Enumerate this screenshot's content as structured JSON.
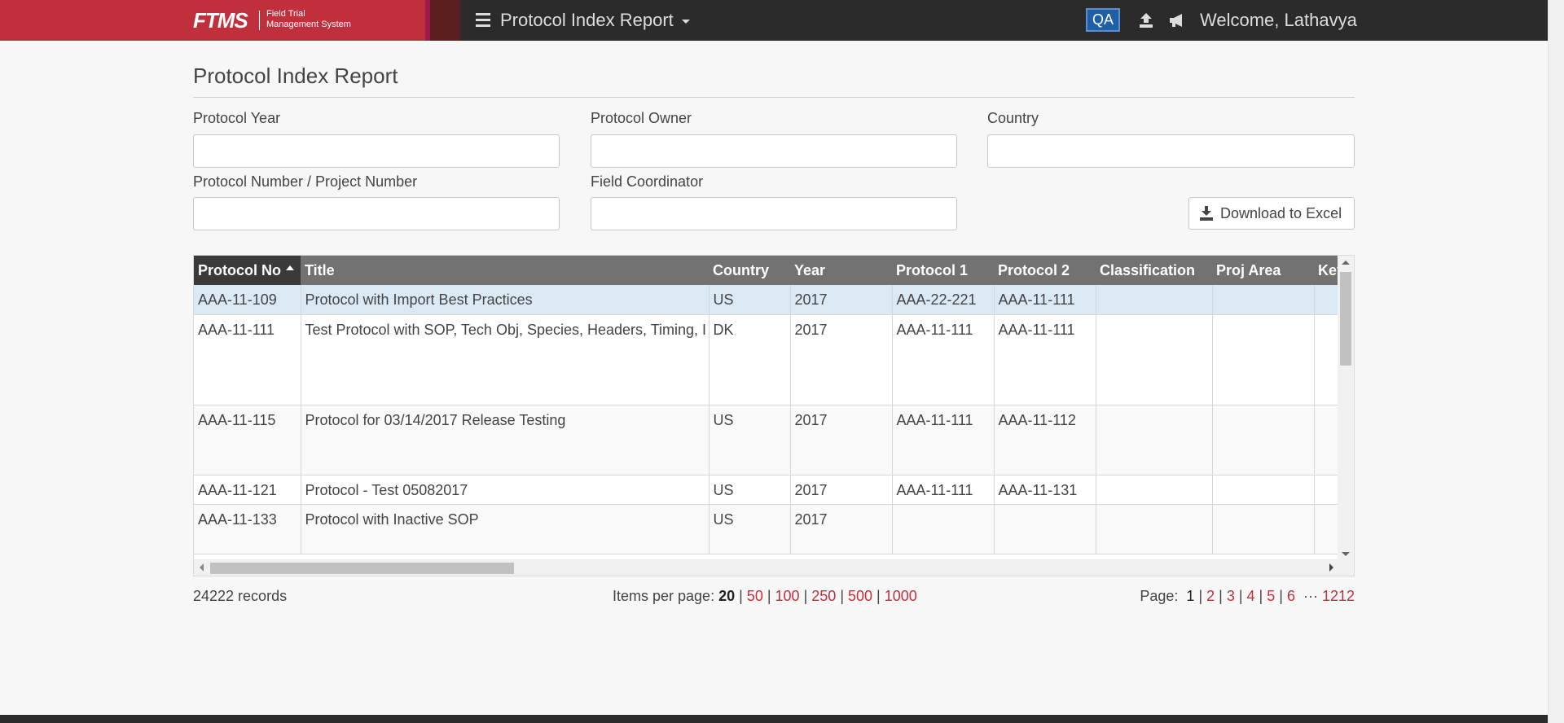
{
  "header": {
    "logo": "FTMS",
    "logo_sub_line1": "Field Trial",
    "logo_sub_line2": "Management System",
    "page_menu_label": "Protocol Index Report",
    "env_badge": "QA",
    "welcome": "Welcome, Lathavya"
  },
  "page": {
    "title": "Protocol Index Report"
  },
  "filters": {
    "protocol_year_label": "Protocol Year",
    "protocol_owner_label": "Protocol Owner",
    "country_label": "Country",
    "protocol_number_label": "Protocol Number / Project Number",
    "field_coordinator_label": "Field Coordinator",
    "protocol_year_value": "",
    "protocol_owner_value": "",
    "country_value": "",
    "protocol_number_value": "",
    "field_coordinator_value": "",
    "download_label": "Download to Excel"
  },
  "grid": {
    "columns": [
      "Protocol No",
      "Title",
      "Country",
      "Year",
      "Protocol 1",
      "Protocol 2",
      "Classification",
      "Proj Area",
      "Key"
    ],
    "rows": [
      [
        "AAA-11-109",
        "Protocol with Import Best Practices",
        "US",
        "2017",
        "AAA-22-221",
        "AAA-11-111",
        "",
        "",
        ""
      ],
      [
        "AAA-11-111",
        "Test Protocol with SOP, Tech Obj, Species, Headers, Timing, I",
        "DK",
        "2017",
        "AAA-11-111",
        "AAA-11-111",
        "",
        "",
        ""
      ],
      [
        "AAA-11-115",
        "Protocol for 03/14/2017 Release Testing",
        "US",
        "2017",
        "AAA-11-111",
        "AAA-11-112",
        "",
        "",
        ""
      ],
      [
        "AAA-11-121",
        "Protocol - Test 05082017",
        "US",
        "2017",
        "AAA-11-111",
        "AAA-11-131",
        "",
        "",
        ""
      ],
      [
        "AAA-11-133",
        "Protocol with Inactive SOP",
        "US",
        "2017",
        "",
        "",
        "",
        "",
        ""
      ]
    ]
  },
  "footer": {
    "records": "24222 records",
    "items_per_page_label": "Items per page:",
    "items_per_page_options": [
      "20",
      "50",
      "100",
      "250",
      "500",
      "1000"
    ],
    "page_label": "Page:",
    "pages": [
      "1",
      "2",
      "3",
      "4",
      "5",
      "6"
    ],
    "ellipsis": "···",
    "last_page": "1212"
  }
}
